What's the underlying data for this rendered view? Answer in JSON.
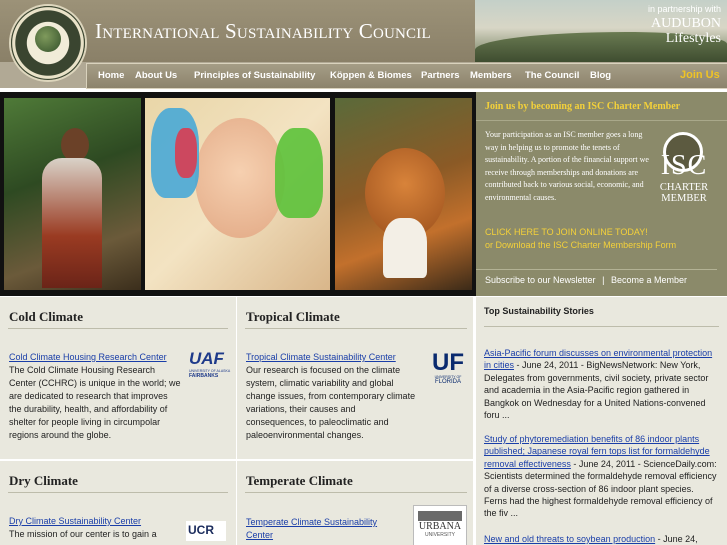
{
  "header": {
    "title": "International Sustainability Council",
    "seal_text": "ISC",
    "partner_label": "in partnership with",
    "partner_name_line1": "AUDUBON",
    "partner_name_line2": "Lifestyles"
  },
  "nav": {
    "items": [
      "Home",
      "About Us",
      "Principles of Sustainability",
      "Köppen & Biomes",
      "Partners",
      "Members",
      "The Council",
      "Blog"
    ],
    "cta": "Join Us"
  },
  "member": {
    "heading": "Join us by becoming an ISC Charter Member",
    "body": "Your participation as an ISC member goes a long way in helping us to promote the tenets of sustainability. A portion of the financial support we receive through memberships and donations are contributed back to various social, economic, and environmental causes.",
    "badge_isc": "ISC",
    "badge_line1": "CHARTER",
    "badge_line2": "MEMBER",
    "click_here": "CLICK HERE TO JOIN ONLINE TODAY!",
    "or": "or",
    "download": "Download the ISC Charter Membership Form",
    "newsletter": "Subscribe to our Newsletter",
    "separator": "|",
    "become": "Become a Member"
  },
  "boxes": {
    "cold": {
      "title": "Cold Climate",
      "link": "Cold Climate Housing Research Center",
      "text": "The Cold Climate Housing Research Center (CCHRC) is unique in the world; we are dedicated to research that improves the durability, health, and affordability of shelter for people living in circumpolar regions around the globe.",
      "logo_main": "UAF",
      "logo_sub1": "UNIVERSITY OF ALASKA",
      "logo_sub2": "FAIRBANKS"
    },
    "tropical": {
      "title": "Tropical Climate",
      "link": "Tropical Climate Sustainability Center",
      "text": "Our research is focused on the climate system, climatic variability and global change issues, from contemporary climate variations, their causes and consequences, to paleoclimatic and paleoenvironmental changes.",
      "logo_main": "UF",
      "logo_sub1": "UNIVERSITY OF",
      "logo_sub2": "FLORIDA"
    },
    "dry": {
      "title": "Dry Climate",
      "link": "Dry Climate Sustainability Center",
      "text": "The mission of our center is to gain a",
      "logo_main": "UCR"
    },
    "temperate": {
      "title": "Temperate Climate",
      "link": "Temperate Climate Sustainability Center",
      "logo_main": "URBANA",
      "logo_sub1": "UNIVERSITY"
    }
  },
  "stories": {
    "title": "Top Sustainability Stories",
    "items": [
      {
        "link": "Asia-Pacific forum discusses on environmental protection in cities",
        "text": " - June 24, 2011 - BigNewsNetwork: New York, Delegates from governments, civil society, private sector and academia in the Asia-Pacific region gathered in Bangkok on Wednesday for a United Nations-convened foru ..."
      },
      {
        "link": "Study of phytoremediation benefits of 86 indoor plants published; Japanese royal fern tops list for formaldehyde removal effectiveness",
        "text": " - June 24, 2011 - ScienceDaily.com: Scientists determined the formaldehyde removal efficiency of a diverse cross-section of 86 indoor plant species. Ferns had the highest formaldehyde removal efficiency of the fiv ..."
      },
      {
        "link": "New and old threats to soybean production",
        "text": " - June 24,"
      }
    ]
  }
}
